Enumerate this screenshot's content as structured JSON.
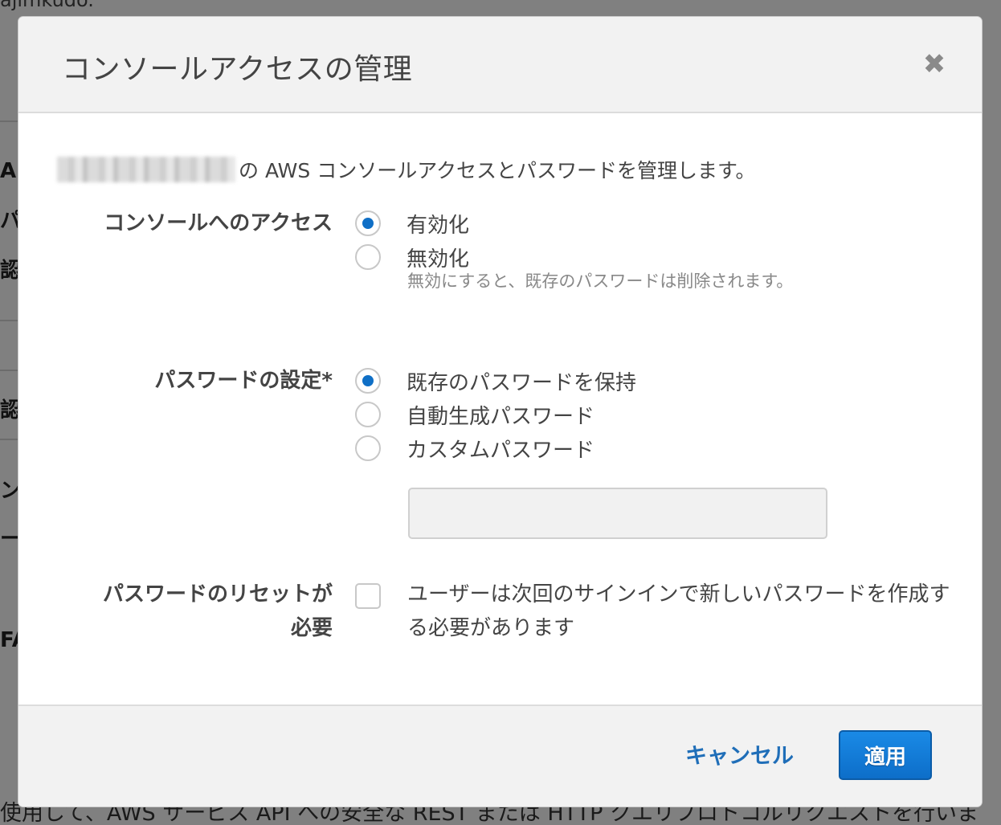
{
  "background": {
    "top_fragment": "ajimkudo.",
    "side_fragments": [
      "A",
      "パ",
      "認",
      "認",
      "ン",
      "ー",
      "FA"
    ],
    "bottom_text": "使用して、AWS サービス API への安全な REST または HTTP クエリプロトコルリクエストを行いま"
  },
  "modal": {
    "title": "コンソールアクセスの管理",
    "close_icon": "close-icon",
    "intro_suffix": "の AWS コンソールアクセスとパスワードを管理します。",
    "console_access": {
      "label": "コンソールへのアクセス",
      "options": [
        {
          "label": "有効化",
          "checked": true
        },
        {
          "label": "無効化",
          "checked": false
        }
      ],
      "disable_hint": "無効にすると、既存のパスワードは削除されます。"
    },
    "password_setting": {
      "label": "パスワードの設定*",
      "options": [
        {
          "label": "既存のパスワードを保持",
          "checked": true
        },
        {
          "label": "自動生成パスワード",
          "checked": false
        },
        {
          "label": "カスタムパスワード",
          "checked": false
        }
      ],
      "custom_value": ""
    },
    "reset": {
      "label_line1": "パスワードのリセットが",
      "label_line2": "必要",
      "checked": false,
      "text": "ユーザーは次回のサインインで新しいパスワードを作成する必要があります"
    },
    "footer": {
      "cancel_label": "キャンセル",
      "apply_label": "適用"
    },
    "colors": {
      "accent": "#0f6fc6",
      "link": "#1f6eb8",
      "header_bg": "#f2f2f2"
    }
  }
}
